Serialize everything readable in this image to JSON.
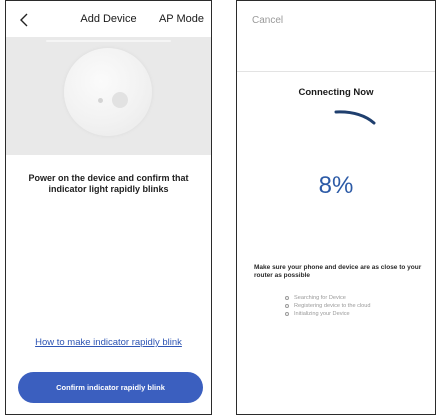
{
  "left_screen": {
    "nav": {
      "title": "Add Device",
      "mode": "AP Mode",
      "back_icon": "chevron-left-icon"
    },
    "illustration_icon": "device-indicator-illustration",
    "instruction": "Power on the device and confirm that indicator light rapidly blinks",
    "help_link": "How to make indicator rapidly blink",
    "confirm_button": "Confirm indicator rapidly blink"
  },
  "right_screen": {
    "cancel": "Cancel",
    "status_title": "Connecting Now",
    "spinner_icon": "loading-arc-icon",
    "progress": "8%",
    "tip": "Make sure your phone and device are as close to your router as possible",
    "steps": [
      {
        "label": "Searching for Device"
      },
      {
        "label": "Registering device to the cloud"
      },
      {
        "label": "Initializing your Device"
      }
    ]
  },
  "colors": {
    "accent": "#3b5fbf",
    "progress": "#2c5aa6",
    "link": "#2e55b4",
    "illustration_bg": "#e9e9e9",
    "muted_text": "#9a9a9a"
  }
}
